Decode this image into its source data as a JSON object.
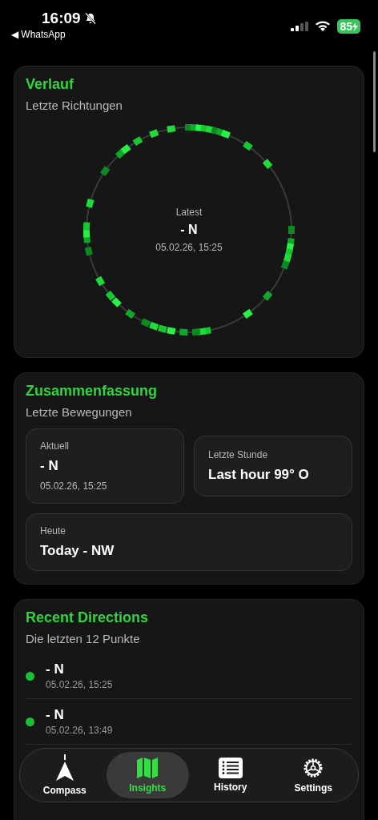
{
  "status_bar": {
    "time": "16:09",
    "back_label": "◀ WhatsApp",
    "battery": "85",
    "muted": true
  },
  "history": {
    "title": "Verlauf",
    "subtitle": "Letzte Richtungen",
    "center_label": "Latest",
    "center_value": "- N",
    "center_time": "05.02.26, 15:25"
  },
  "summary": {
    "title": "Zusammenfassung",
    "subtitle": "Letzte Bewegungen",
    "tiles": [
      {
        "label": "Aktuell",
        "value": "- N",
        "time": "05.02.26, 15:25"
      },
      {
        "label": "Letzte Stunde",
        "value": "Last hour 99° O"
      },
      {
        "label": "Heute",
        "value": "Today - NW"
      }
    ]
  },
  "recent": {
    "title": "Recent Directions",
    "subtitle": "Die letzten 12 Punkte",
    "items": [
      {
        "direction": "- N",
        "time": "05.02.26, 15:25"
      },
      {
        "direction": "- N",
        "time": "05.02.26, 13:49"
      }
    ]
  },
  "tabs": [
    {
      "label": "Compass",
      "selected": false
    },
    {
      "label": "Insights",
      "selected": true
    },
    {
      "label": "History",
      "selected": false
    },
    {
      "label": "Settings",
      "selected": false
    }
  ]
}
